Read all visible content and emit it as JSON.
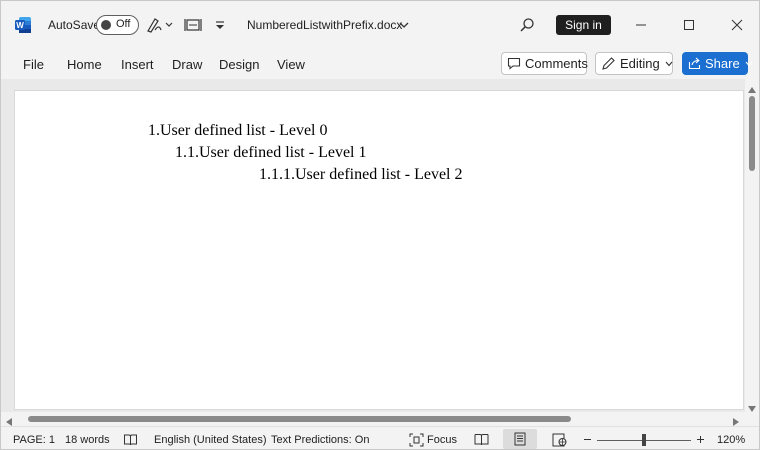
{
  "titlebar": {
    "app_icon": "word-logo",
    "autosave_label": "AutoSave",
    "autosave_state": "Off",
    "doc_title": "NumberedListwithPrefix.docx",
    "sign_in_label": "Sign in"
  },
  "menu": {
    "items": [
      "File",
      "Home",
      "Insert",
      "Draw",
      "Design",
      "View"
    ],
    "comments_label": "Comments",
    "editing_label": "Editing",
    "share_label": "Share"
  },
  "document": {
    "lines": [
      "1.User defined list - Level 0",
      "1.1.User defined list - Level 1",
      "1.1.1.User defined list - Level 2"
    ]
  },
  "status": {
    "page": "PAGE: 1",
    "words": "18 words",
    "language": "English (United States)",
    "text_predictions": "Text Predictions: On",
    "focus": "Focus",
    "zoom": "120%",
    "zoom_fraction": 0.5
  },
  "colors": {
    "accent": "#1a6fd1",
    "word_blue": "#185abd"
  }
}
